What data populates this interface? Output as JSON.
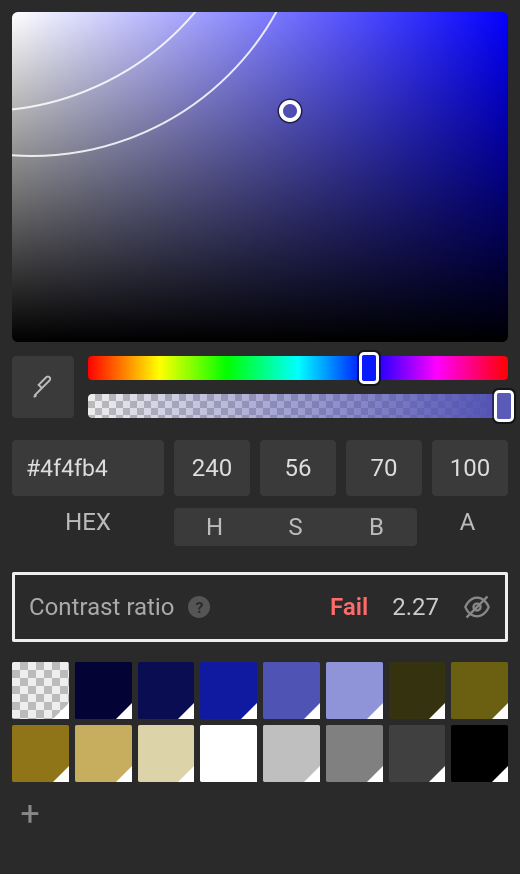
{
  "color": {
    "hex": "#4f4fb4",
    "h": "240",
    "s": "56",
    "b": "70",
    "a": "100"
  },
  "labels": {
    "hex": "HEX",
    "h": "H",
    "s": "S",
    "b": "B",
    "a": "A"
  },
  "contrast": {
    "label": "Contrast ratio",
    "status": "Fail",
    "value": "2.27"
  },
  "swatches": [
    {
      "color": "transparent",
      "transparent": true
    },
    {
      "color": "#030336"
    },
    {
      "color": "#0a0d52"
    },
    {
      "color": "#0f1aa0"
    },
    {
      "color": "#4f53b4"
    },
    {
      "color": "#8f93d8"
    },
    {
      "color": "#35320f"
    },
    {
      "color": "#6b5f12"
    },
    {
      "color": "#8f7518"
    },
    {
      "color": "#c7ae5e"
    },
    {
      "color": "#ddd3a9"
    },
    {
      "color": "#ffffff"
    },
    {
      "color": "#bfbfbf"
    },
    {
      "color": "#808080"
    },
    {
      "color": "#404040"
    },
    {
      "color": "#000000"
    }
  ],
  "colors": {
    "fail": "#ff6b6b",
    "accent": "#4f4fb4"
  }
}
